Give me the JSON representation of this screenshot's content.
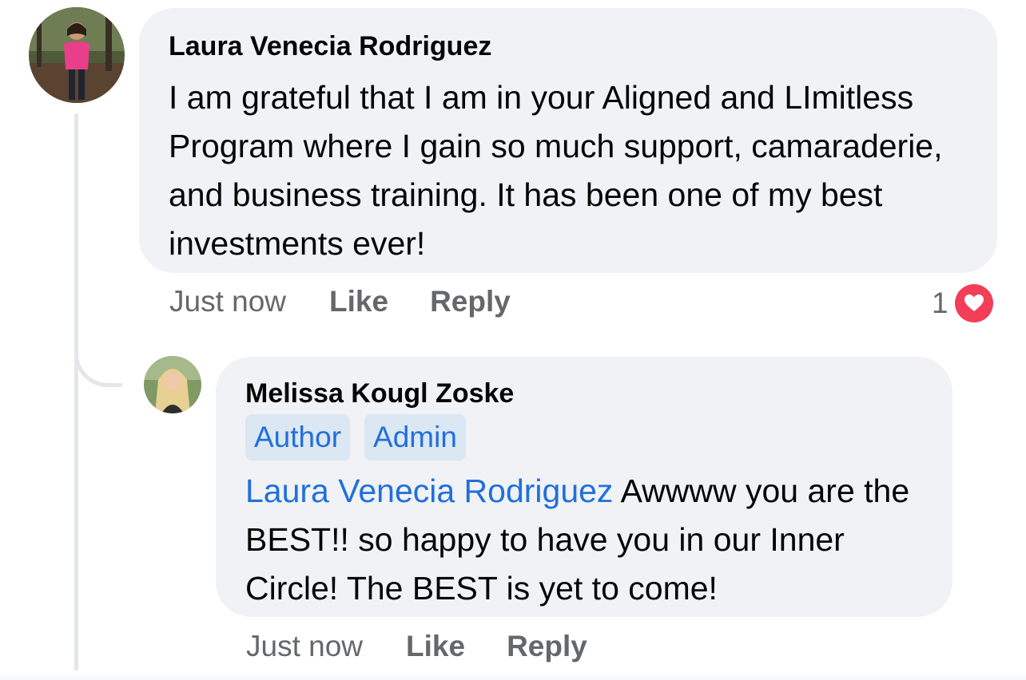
{
  "comment": {
    "author": "Laura Venecia Rodriguez",
    "text": "I am grateful that I am in your Aligned and LImitless Program where I gain so much support, camaraderie, and business training. It has been one of my best investments ever!",
    "timestamp": "Just now",
    "like_label": "Like",
    "reply_label": "Reply",
    "reaction_count": "1",
    "reaction_icon": "heart-icon",
    "reaction_color": "#f33e58"
  },
  "reply": {
    "author": "Melissa Kougl Zoske",
    "badges": [
      "Author",
      "Admin"
    ],
    "mention": "Laura Venecia Rodriguez",
    "text": " Awwww you are the BEST!! so happy to have you in our Inner Circle! The BEST is yet to come!",
    "timestamp": "Just now",
    "like_label": "Like",
    "reply_label": "Reply"
  },
  "colors": {
    "bubble": "#f0f2f5",
    "link": "#216fdb",
    "badge_bg": "#dbe7f2",
    "secondary_text": "#65676b"
  }
}
